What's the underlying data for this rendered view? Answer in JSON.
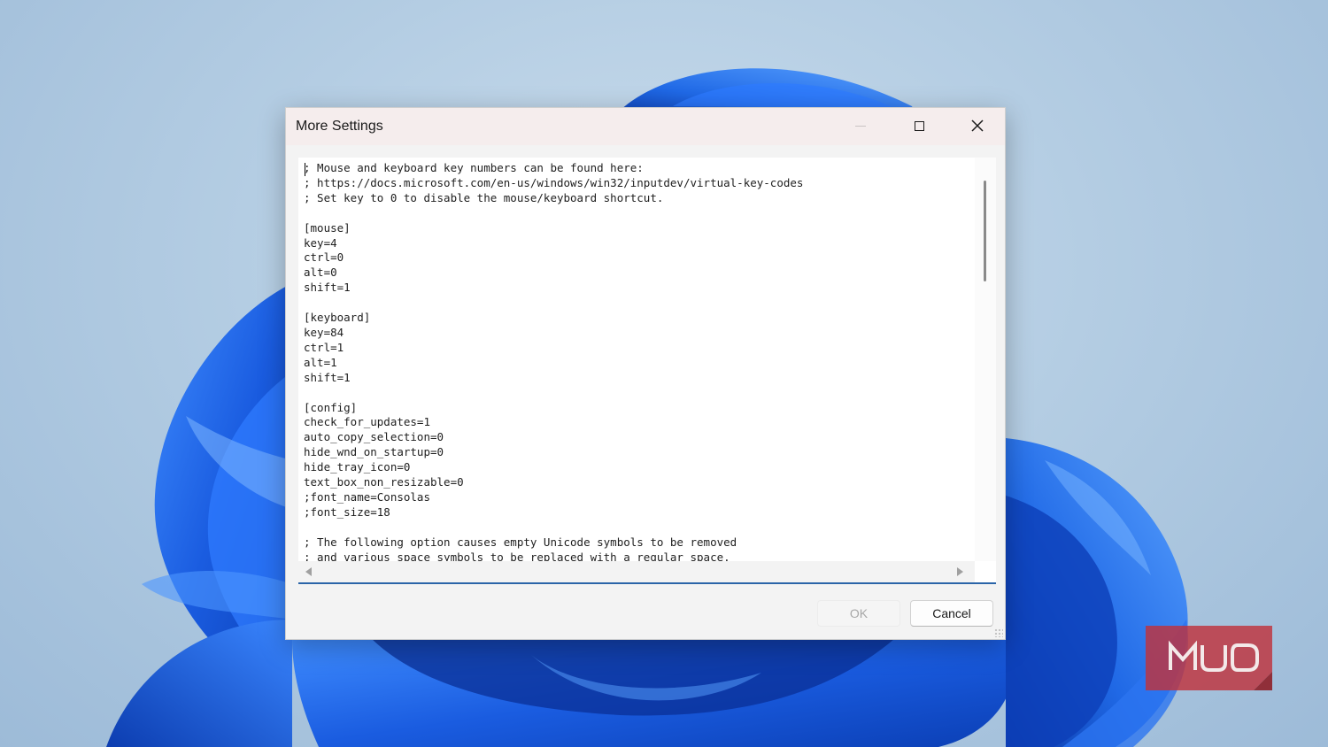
{
  "window": {
    "title": "More Settings"
  },
  "icons": {
    "minimize": "minimize-icon",
    "maximize": "maximize-icon",
    "close": "close-icon",
    "scroll_left": "scroll-left-arrow-icon",
    "scroll_right": "scroll-right-arrow-icon",
    "resize_grip": "resize-grip-icon"
  },
  "editor": {
    "content": "; Mouse and keyboard key numbers can be found here:\n; https://docs.microsoft.com/en-us/windows/win32/inputdev/virtual-key-codes\n; Set key to 0 to disable the mouse/keyboard shortcut.\n\n[mouse]\nkey=4\nctrl=0\nalt=0\nshift=1\n\n[keyboard]\nkey=84\nctrl=1\nalt=1\nshift=1\n\n[config]\ncheck_for_updates=1\nauto_copy_selection=0\nhide_wnd_on_startup=0\nhide_tray_icon=0\ntext_box_non_resizable=0\n;font_name=Consolas\n;font_size=18\n\n; The following option causes empty Unicode symbols to be removed\n; and various space symbols to be replaced with a regular space."
  },
  "buttons": {
    "ok": "OK",
    "cancel": "Cancel"
  },
  "watermark": {
    "text": "MUO",
    "color": "#c0323c"
  },
  "colors": {
    "wallpaper_bloom": "#1f63e0",
    "focus_underline": "#2a64a8"
  }
}
